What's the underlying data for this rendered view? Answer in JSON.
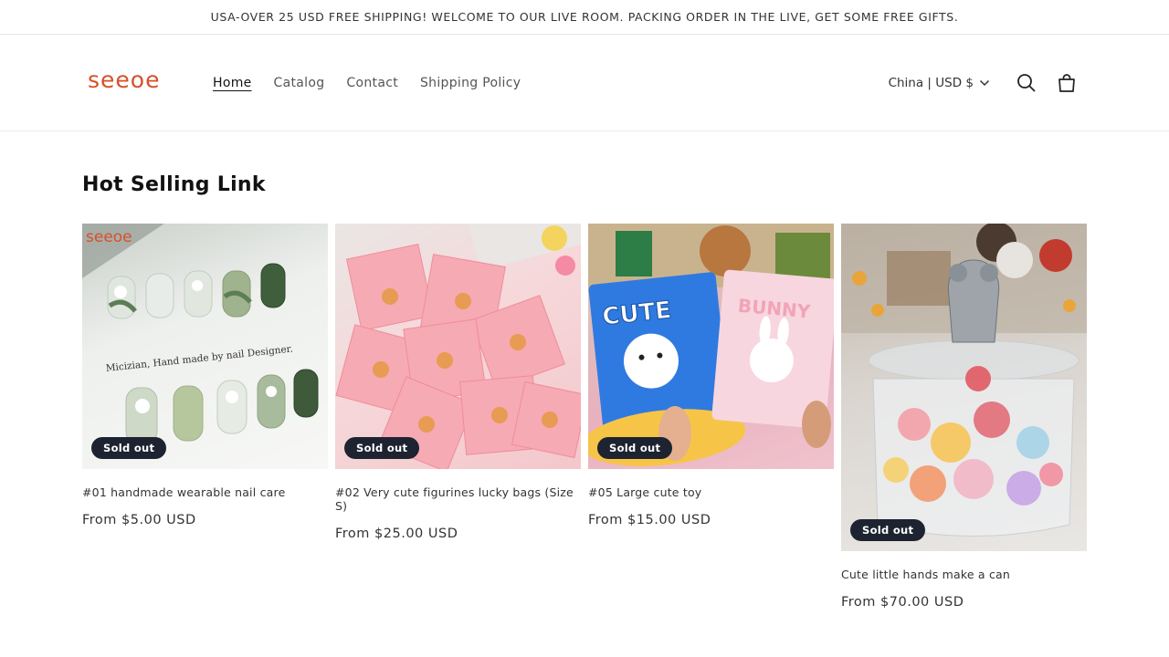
{
  "announcement": "USA-OVER 25 USD FREE SHIPPING! WELCOME TO OUR LIVE ROOM. PACKING ORDER IN THE LIVE, GET SOME FREE GIFTS.",
  "logo": "seeoe",
  "nav": [
    {
      "label": "Home"
    },
    {
      "label": "Catalog"
    },
    {
      "label": "Contact"
    },
    {
      "label": "Shipping Policy"
    }
  ],
  "locale": "China | USD $",
  "icons": {
    "locale": "chevron-down-icon",
    "search": "search-icon",
    "cart": "cart-icon"
  },
  "section_title": "Hot Selling Link",
  "products": [
    {
      "title": "#01 handmade wearable nail care",
      "price": "From $5.00 USD",
      "badge": "Sold out",
      "image_text": "Micizian, Hand made by nail Designer.",
      "image_logo": "seeoe"
    },
    {
      "title": "#02 Very cute figurines lucky bags (Size S)",
      "price": "From $25.00 USD",
      "badge": "Sold out"
    },
    {
      "title": "#05 Large cute toy",
      "price": "From $15.00 USD",
      "badge": "Sold out",
      "image_text_1": "CUTE",
      "image_text_2": "BUNNY"
    },
    {
      "title": "Cute little hands make a can",
      "price": "From $70.00 USD",
      "badge": "Sold out"
    }
  ],
  "colors": {
    "brand": "#d9502a",
    "badge": "#1d2330",
    "text": "#121212"
  }
}
